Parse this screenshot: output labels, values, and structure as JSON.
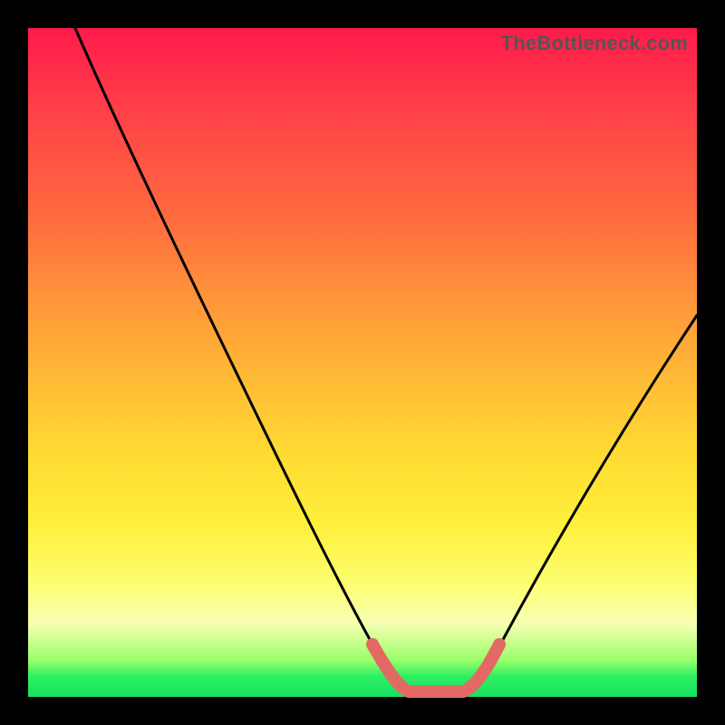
{
  "watermark": "TheBottleneck.com",
  "chart_data": {
    "type": "line",
    "title": "",
    "xlabel": "",
    "ylabel": "",
    "xlim": [
      0,
      100
    ],
    "ylim": [
      0,
      100
    ],
    "series": [
      {
        "name": "black-curve",
        "color": "#000000",
        "points": [
          {
            "x": 7,
            "y": 100
          },
          {
            "x": 12,
            "y": 88
          },
          {
            "x": 20,
            "y": 71
          },
          {
            "x": 30,
            "y": 50
          },
          {
            "x": 40,
            "y": 30
          },
          {
            "x": 48,
            "y": 12
          },
          {
            "x": 52,
            "y": 4
          },
          {
            "x": 55,
            "y": 1
          },
          {
            "x": 60,
            "y": 0
          },
          {
            "x": 65,
            "y": 1
          },
          {
            "x": 68,
            "y": 4
          },
          {
            "x": 74,
            "y": 13
          },
          {
            "x": 82,
            "y": 27
          },
          {
            "x": 90,
            "y": 41
          },
          {
            "x": 100,
            "y": 57
          }
        ]
      },
      {
        "name": "red-valley-overlay",
        "color": "#e36a64",
        "points": [
          {
            "x": 52,
            "y": 4
          },
          {
            "x": 55,
            "y": 1
          },
          {
            "x": 60,
            "y": 0
          },
          {
            "x": 65,
            "y": 1
          },
          {
            "x": 68,
            "y": 4
          }
        ]
      }
    ],
    "annotations": []
  }
}
